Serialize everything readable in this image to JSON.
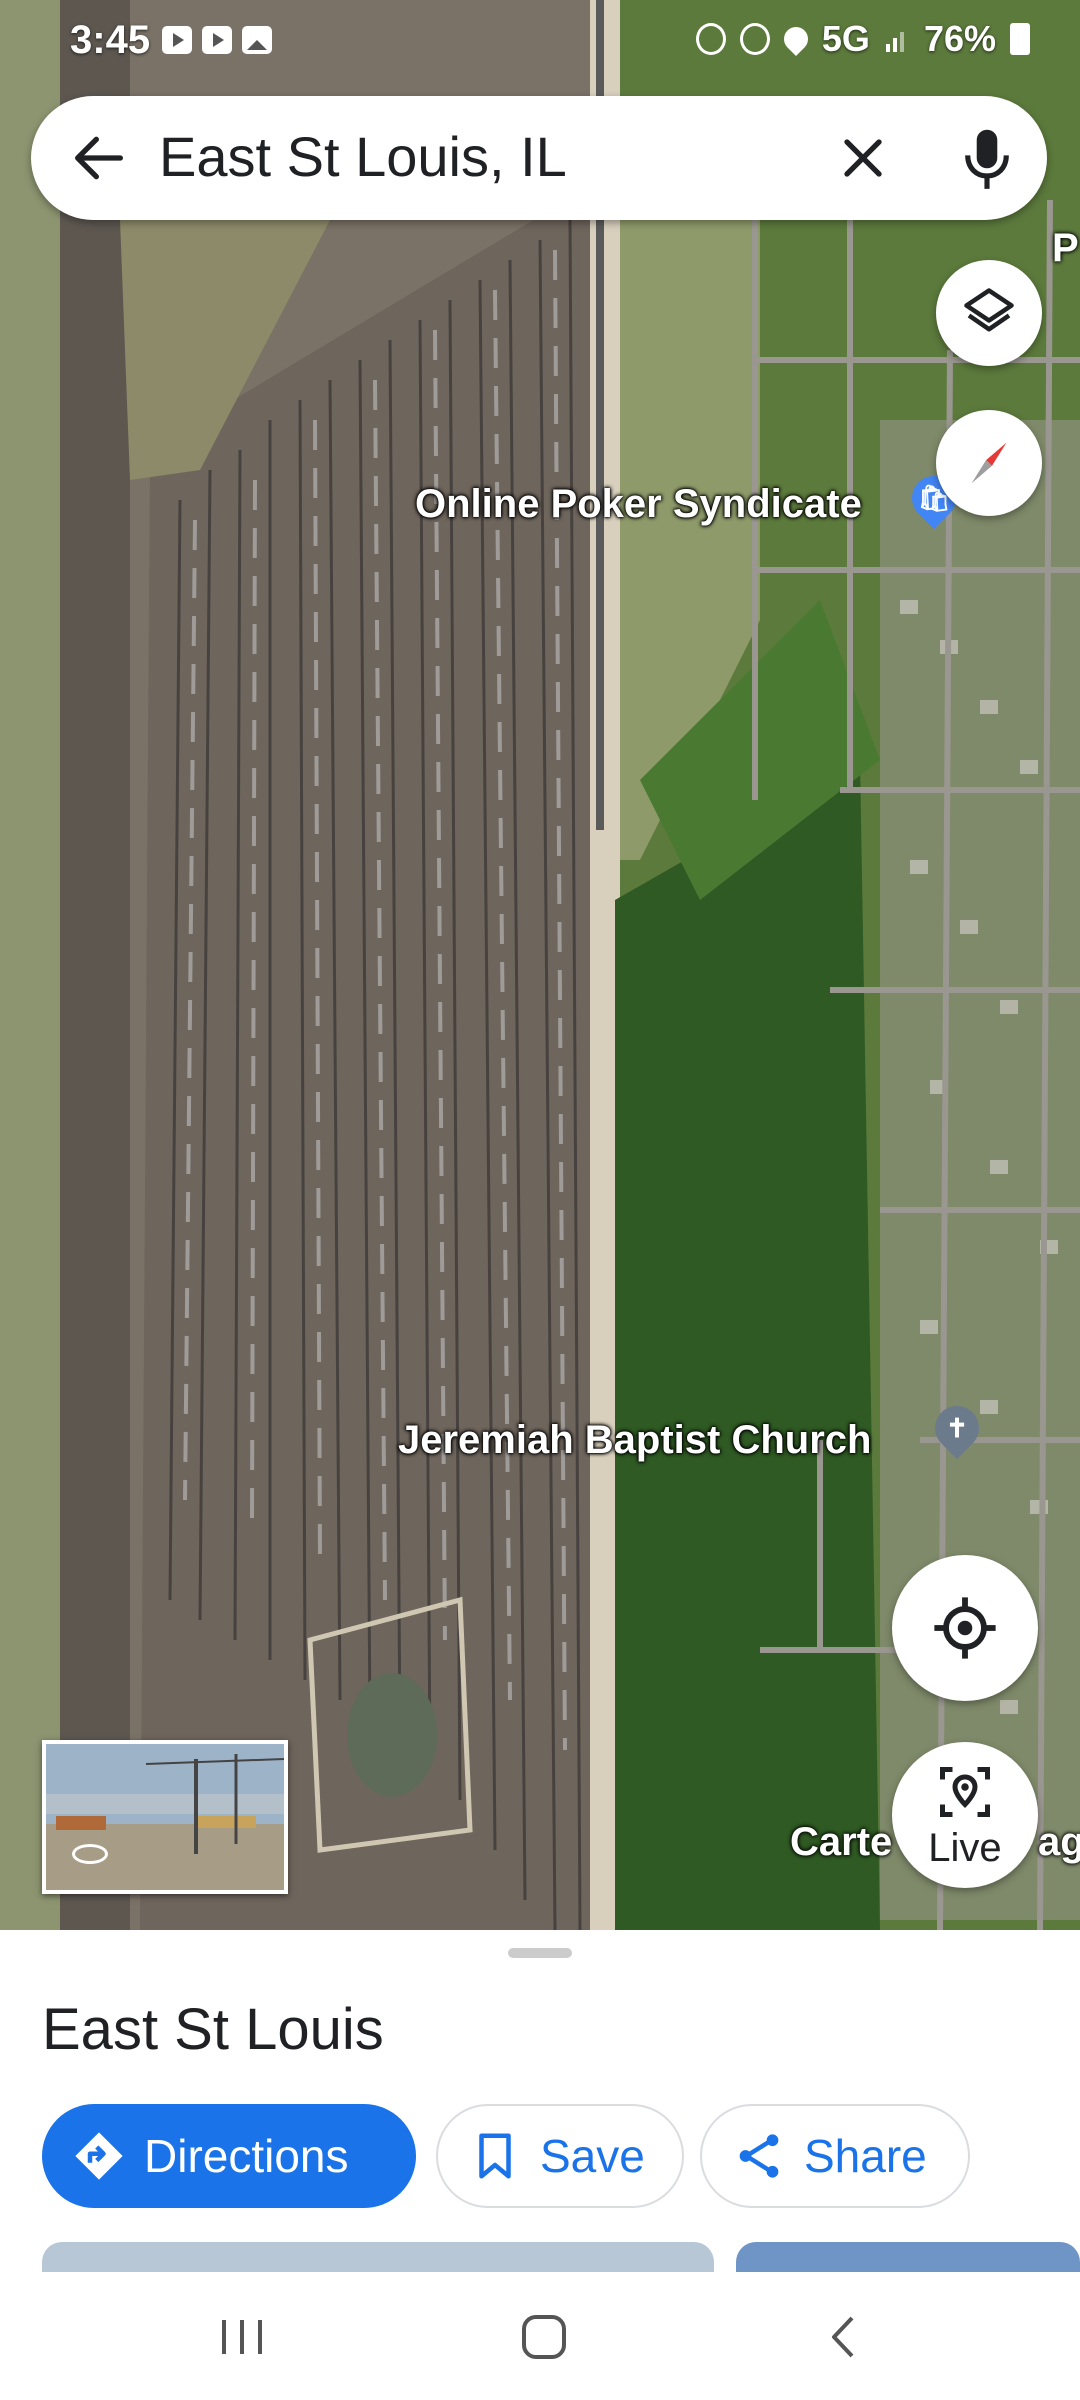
{
  "status_bar": {
    "time": "3:45",
    "network": "5G",
    "battery": "76%",
    "left_icons": [
      "youtube-icon",
      "youtube-icon",
      "gallery-icon"
    ],
    "right_icons": [
      "android-system-icon",
      "alarm-icon",
      "location-icon",
      "signal-icon",
      "battery-icon"
    ]
  },
  "search": {
    "query": "East St Louis, IL"
  },
  "map": {
    "view": "satellite",
    "labels": {
      "poker": "Online Poker Syndicate",
      "church": "Jeremiah Baptist Church",
      "carter_edge": "Carte",
      "edge_right": "ag",
      "top_edge": "P"
    },
    "controls": {
      "live_label": "Live"
    }
  },
  "place_sheet": {
    "title": "East St Louis",
    "buttons": {
      "directions": "Directions",
      "save": "Save",
      "share": "Share"
    }
  },
  "colors": {
    "accent": "#1a73e8",
    "poi_shopping": "#4285f4",
    "poi_church": "#6b7b8c",
    "compass_red": "#e53935"
  }
}
